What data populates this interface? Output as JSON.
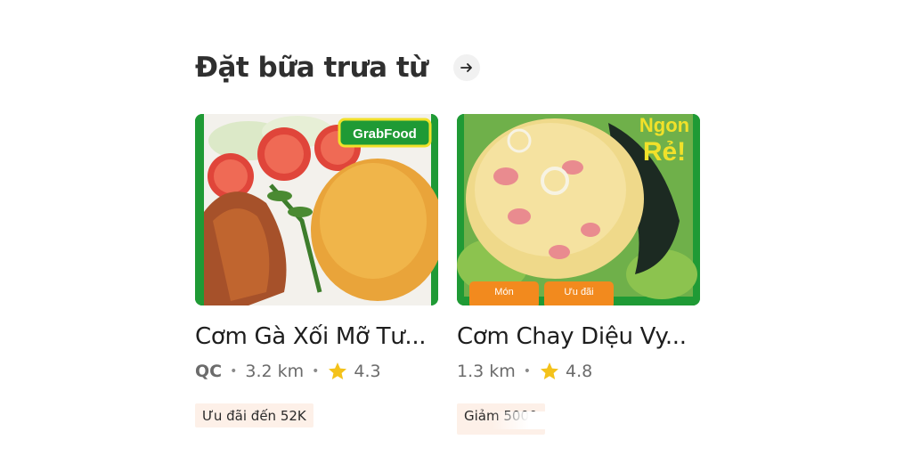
{
  "section": {
    "title": "Đặt bữa trưa từ",
    "arrow_icon": "arrow-right-icon"
  },
  "restaurants": [
    {
      "name": "Cơm Gà Xối Mỡ Tư...",
      "ad_label": "QC",
      "distance": "3.2 km",
      "rating": "4.3",
      "promo": "Ưu đãi đến 52K",
      "image_badge": "GrabFood"
    },
    {
      "name": "Cơm Chay Diệu Vy...",
      "distance": "1.3 km",
      "rating": "4.8",
      "promo": "Giảm 5000",
      "image_badge_line1": "Ngon",
      "image_badge_line2": "Rẻ!",
      "image_tag_left": "Món",
      "image_tag_right": "Ưu đãi"
    }
  ],
  "colors": {
    "grab_green": "#1f9a35",
    "star_yellow": "#f4c21a",
    "promo_bg": "#fdf0e8"
  }
}
